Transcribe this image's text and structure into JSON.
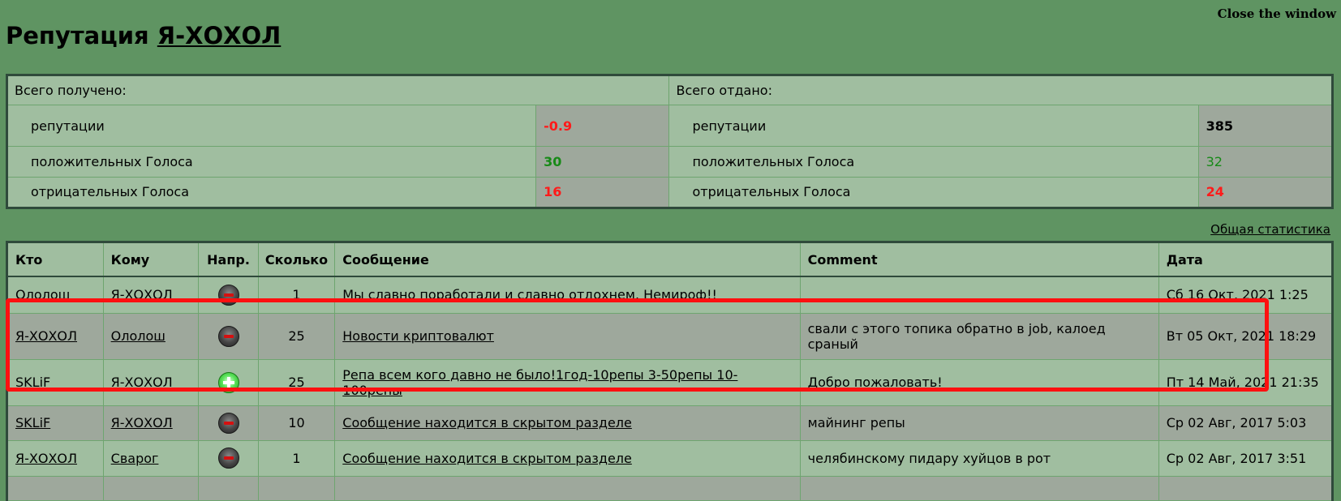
{
  "close_label": "Close the window",
  "header": {
    "title_prefix": "Репутация",
    "user_name": "Я-ХОХОЛ"
  },
  "summary": {
    "received_label": "Всего получено:",
    "given_label": "Всего отдано:",
    "rows": [
      {
        "label": "репутации",
        "received": "-0.9",
        "given": "385"
      },
      {
        "label": "положительных Голоса",
        "received": "30",
        "given": "32"
      },
      {
        "label": "отрицательных Голоса",
        "received": "16",
        "given": "24"
      }
    ]
  },
  "stats_link": "Общая статистика",
  "log": {
    "columns": [
      "Кто",
      "Кому",
      "Напр.",
      "Сколько",
      "Сообщение",
      "Comment",
      "Дата"
    ],
    "rows": [
      {
        "from": "Ололош",
        "to": "Я-ХОХОЛ",
        "direction": "minus",
        "amount": "1",
        "message": "Мы славно поработали и славно отдохнем. Немироф!!",
        "comment": "",
        "date": "Сб 16 Окт, 2021 1:25"
      },
      {
        "from": "Я-ХОХОЛ",
        "to": "Ололош",
        "direction": "minus",
        "amount": "25",
        "message": "Новости криптовалют",
        "comment": "свали с этого топика обратно в job, калоед сраный",
        "date": "Вт 05 Окт, 2021 18:29"
      },
      {
        "from": "SKLiF",
        "to": "Я-ХОХОЛ",
        "direction": "plus",
        "amount": "25",
        "message": "Репа всем кого давно не было!1год-10репы 3-50репы 10-100репы",
        "comment": "Добро пожаловать!",
        "date": "Пт 14 Май, 2021 21:35"
      },
      {
        "from": "SKLiF",
        "to": "Я-ХОХОЛ",
        "direction": "minus",
        "amount": "10",
        "message": "Сообщение находится в скрытом разделе",
        "comment": "майнинг репы",
        "date": "Ср 02 Авг, 2017 5:03"
      },
      {
        "from": "Я-ХОХОЛ",
        "to": "Сварог",
        "direction": "minus",
        "amount": "1",
        "message": "Сообщение находится в скрытом разделе",
        "comment": "челябинскому пидару хуйцов в рот",
        "date": "Ср 02 Авг, 2017 3:51"
      }
    ]
  },
  "colors": {
    "page_bg": "#5f9462",
    "cell_bg": "#a0bea0",
    "cell_alt_bg": "#9ea89c",
    "negative": "#ff1a1a",
    "positive": "#178a17",
    "highlight": "#ff1010"
  }
}
